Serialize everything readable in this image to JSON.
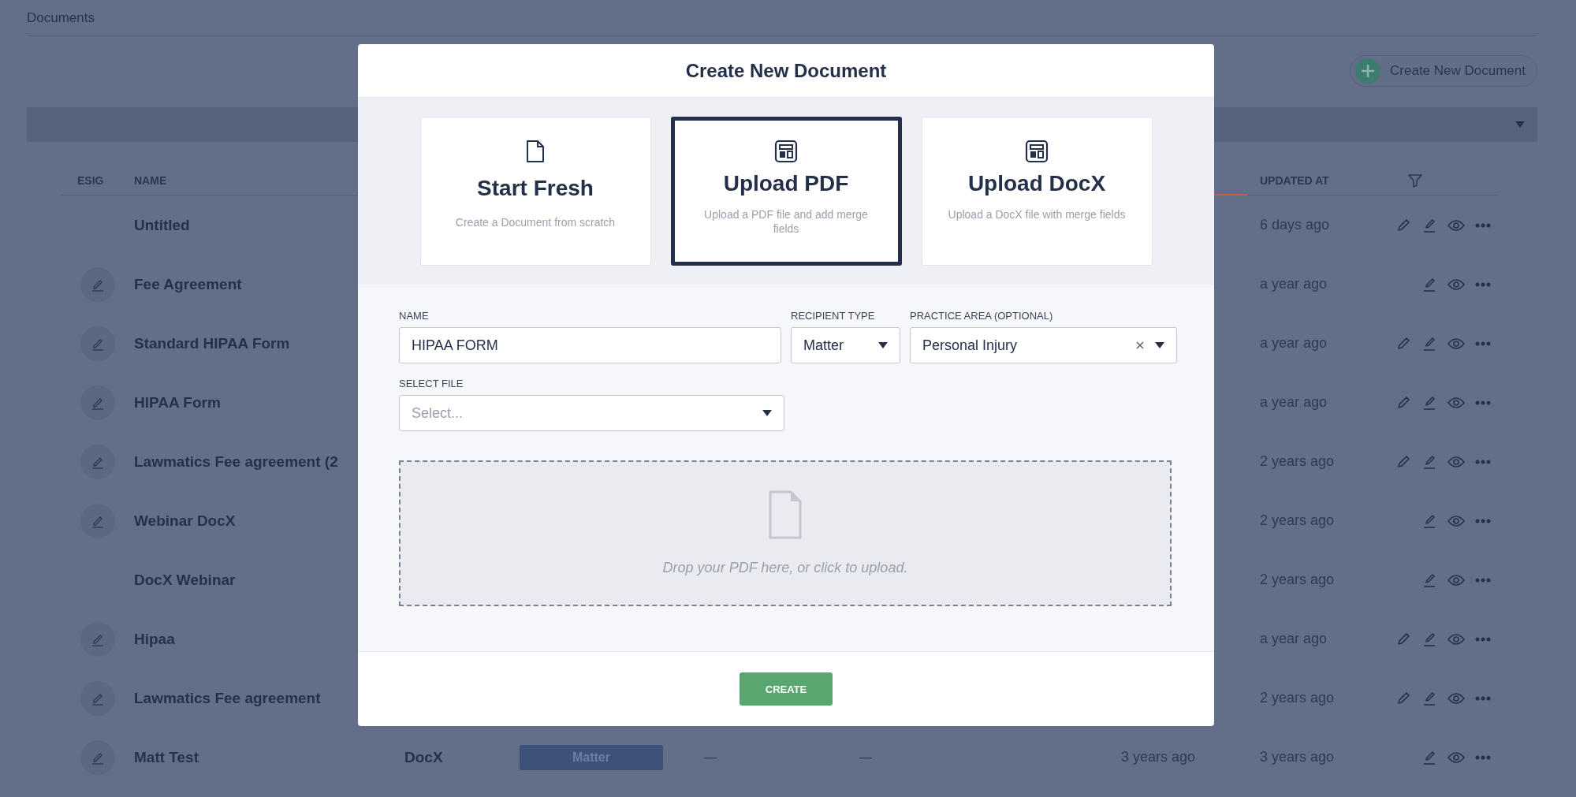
{
  "page": {
    "title": "Documents",
    "create_button": "Create New Document"
  },
  "table": {
    "columns": [
      {
        "label": "ESIG"
      },
      {
        "label": "NAME"
      },
      {
        "label": "UPDATED AT"
      }
    ],
    "rows": [
      {
        "name": "Untitled",
        "esig": false,
        "editable": true,
        "updated_at": "6 days ago"
      },
      {
        "name": "Fee Agreement",
        "esig": true,
        "editable": false,
        "updated_at": "a year ago"
      },
      {
        "name": "Standard HIPAA Form",
        "esig": true,
        "editable": true,
        "updated_at": "a year ago"
      },
      {
        "name": "HIPAA Form",
        "esig": true,
        "editable": true,
        "updated_at": "a year ago"
      },
      {
        "name": "Lawmatics Fee agreement (2",
        "esig": true,
        "editable": true,
        "updated_at": "2 years ago"
      },
      {
        "name": "Webinar DocX",
        "esig": true,
        "editable": false,
        "updated_at": "2 years ago"
      },
      {
        "name": "DocX Webinar",
        "esig": false,
        "editable": false,
        "updated_at": "2 years ago"
      },
      {
        "name": "Hipaa",
        "esig": true,
        "editable": true,
        "updated_at": "a year ago"
      },
      {
        "name": "Lawmatics Fee agreement",
        "esig": true,
        "editable": true,
        "updated_at": "2 years ago"
      },
      {
        "name": "Matt Test",
        "esig": true,
        "editable": false,
        "column_3": "DocX",
        "column_4": "Matter",
        "column_5": "—",
        "column_6": "—",
        "column_7": "3 years ago",
        "updated_at": "3 years ago"
      }
    ]
  },
  "modal": {
    "title": "Create New Document",
    "options": [
      {
        "kind": "blank",
        "title": "Start Fresh",
        "description": "Create a Document from scratch",
        "selected": false
      },
      {
        "kind": "layout",
        "title": "Upload PDF",
        "description": "Upload a PDF file and add merge fields",
        "selected": true
      },
      {
        "kind": "layout",
        "title": "Upload DocX",
        "description": "Upload a DocX file with merge fields",
        "selected": false
      }
    ],
    "name_field": {
      "label": "NAME",
      "value": "HIPAA FORM"
    },
    "recipient_type": {
      "label": "RECIPIENT TYPE",
      "value": "Matter"
    },
    "practice_area": {
      "label": "PRACTICE AREA (OPTIONAL)",
      "value": "Personal Injury",
      "clearable": true
    },
    "select_file": {
      "label": "SELECT FILE",
      "placeholder": "Select..."
    },
    "dropzone": {
      "text": "Drop your PDF here, or click to upload."
    },
    "create_button": "CREATE"
  }
}
